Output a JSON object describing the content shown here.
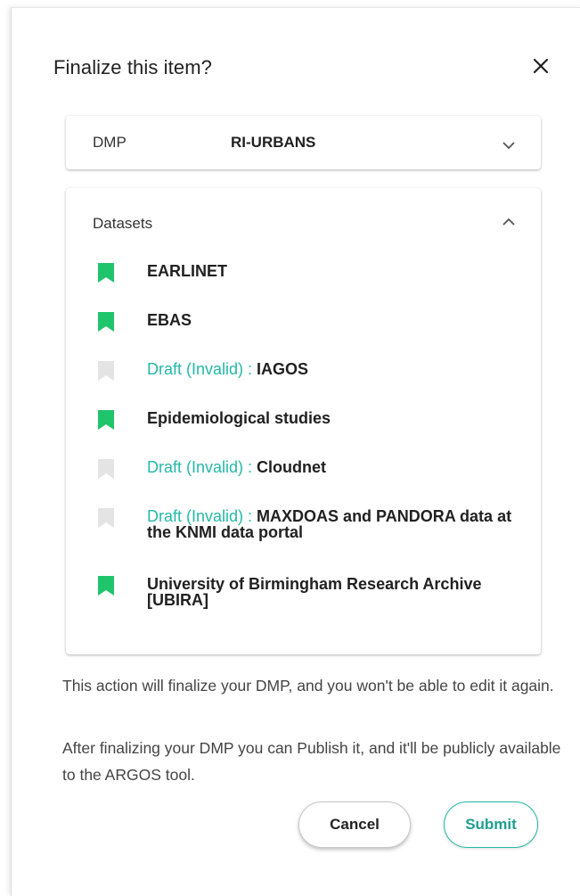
{
  "dialog": {
    "title": "Finalize this item?",
    "close_icon": "close-icon"
  },
  "dmp": {
    "label": "DMP",
    "value": "RI-URBANS",
    "chevron_icon": "chevron-down-icon"
  },
  "datasets": {
    "title": "Datasets",
    "chevron_icon": "chevron-up-icon",
    "draft_prefix": "Draft (Invalid) :",
    "items": [
      {
        "name": "EARLINET",
        "draft": false
      },
      {
        "name": "EBAS",
        "draft": false
      },
      {
        "name": "IAGOS",
        "draft": true
      },
      {
        "name": "Epidemiological studies",
        "draft": false
      },
      {
        "name": "Cloudnet",
        "draft": true
      },
      {
        "name": "MAXDOAS and PANDORA data at the KNMI data portal",
        "draft": true
      },
      {
        "name": "University of Birmingham Research Archive [UBIRA]",
        "draft": false
      }
    ]
  },
  "info": {
    "line1": "This action will finalize your DMP, and you won't be able to edit it again.",
    "line2": "After finalizing your DMP you can Publish it, and it'll be publicly available to the ARGOS tool."
  },
  "actions": {
    "cancel_label": "Cancel",
    "submit_label": "Submit"
  },
  "colors": {
    "accent": "#23b9a6",
    "valid_bookmark": "#1fc46b",
    "draft_bookmark": "#e4e4e4"
  }
}
